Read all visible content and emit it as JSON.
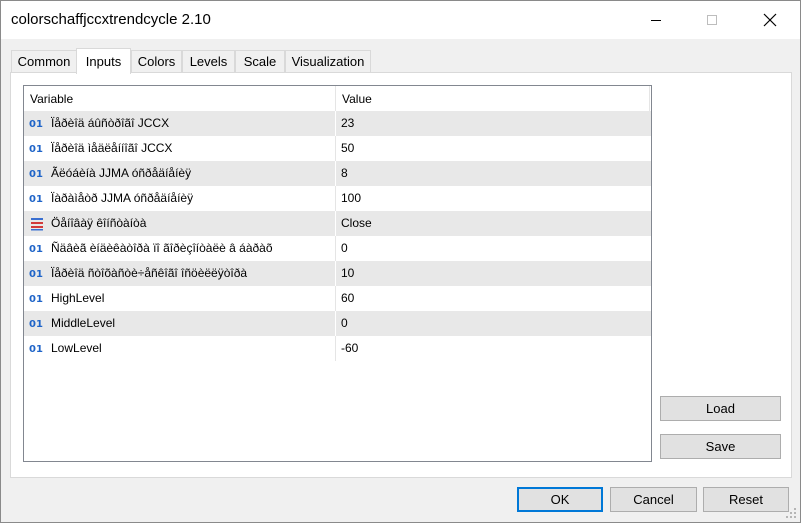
{
  "window": {
    "title": "colorschaffjccxtrendcycle 2.10"
  },
  "tabs": [
    {
      "label": "Common"
    },
    {
      "label": "Inputs"
    },
    {
      "label": "Colors"
    },
    {
      "label": "Levels"
    },
    {
      "label": "Scale"
    },
    {
      "label": "Visualization"
    }
  ],
  "active_tab": "Inputs",
  "grid": {
    "headers": {
      "variable": "Variable",
      "value": "Value"
    },
    "rows": [
      {
        "icon": "int-icon",
        "icon_text": "01",
        "name": "Ïåðèîä áûñòðîãî JCCX",
        "value": "23"
      },
      {
        "icon": "int-icon",
        "icon_text": "01",
        "name": "Ïåðèîä ìåäëåííîãî JCCX",
        "value": "50"
      },
      {
        "icon": "int-icon",
        "icon_text": "01",
        "name": "Ãëóáèíà JJMA óñðåäíåíèÿ",
        "value": "8"
      },
      {
        "icon": "int-icon",
        "icon_text": "01",
        "name": "Ïàðàìåòð JJMA óñðåäíåíèÿ",
        "value": "100"
      },
      {
        "icon": "enum-icon",
        "icon_text": "",
        "name": "Öåíîâàÿ êîíñòàíòà",
        "value": "Close"
      },
      {
        "icon": "int-icon",
        "icon_text": "01",
        "name": "Ñäâèã èíäèêàòîðà ïî ãîðèçîíòàëè â áàðàõ",
        "value": "0"
      },
      {
        "icon": "int-icon",
        "icon_text": "01",
        "name": "Ïåðèîä ñòîõàñòè÷åñêîãî îñöèëëÿòîðà",
        "value": "10"
      },
      {
        "icon": "int-icon",
        "icon_text": "01",
        "name": "HighLevel",
        "value": "60"
      },
      {
        "icon": "int-icon",
        "icon_text": "01",
        "name": "MiddleLevel",
        "value": "0"
      },
      {
        "icon": "int-icon",
        "icon_text": "01",
        "name": "LowLevel",
        "value": "-60"
      }
    ]
  },
  "buttons": {
    "load": "Load",
    "save": "Save",
    "ok": "OK",
    "cancel": "Cancel",
    "reset": "Reset"
  },
  "colors": {
    "accent": "#0078d7",
    "int_icon": "#1f64c8",
    "row_shade": "#e8e8e8"
  }
}
